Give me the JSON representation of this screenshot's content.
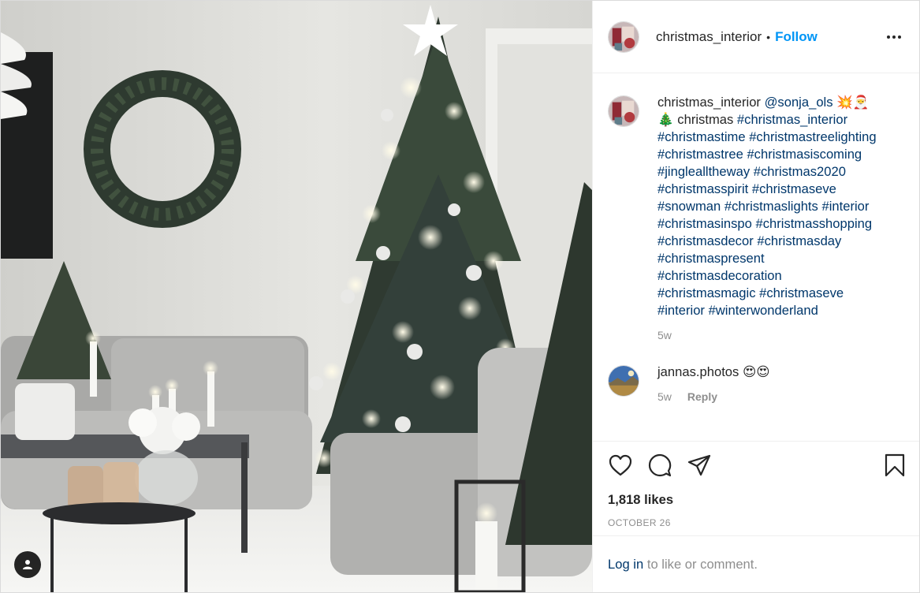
{
  "post": {
    "username": "christmas_interior",
    "separator": "•",
    "follow_label": "Follow",
    "more_icon": "more-horizontal-icon"
  },
  "caption": {
    "username": "christmas_interior",
    "mention": "@sonja_ols",
    "emoji": "💥🎅",
    "line2_emoji": "🎄",
    "line2_word": "christmas",
    "hashtags": [
      "#christmas_interior",
      "#christmastime",
      "#christmastreelighting",
      "#christmastree",
      "#christmasiscoming",
      "#jinglealltheway",
      "#christmas2020",
      "#christmasspirit",
      "#christmaseve",
      "#snowman",
      "#christmaslights",
      "#interior",
      "#christmasinspo",
      "#christmasshopping",
      "#christmasdecor",
      "#christmasday",
      "#christmaspresent",
      "#christmasdecoration",
      "#christmasmagic",
      "#christmaseve",
      "#interior",
      "#winterwonderland"
    ],
    "time": "5w"
  },
  "comments": [
    {
      "username": "jannas.photos",
      "text": "😍😍",
      "time": "5w",
      "reply_label": "Reply"
    }
  ],
  "actions": {
    "like_icon": "heart-icon",
    "comment_icon": "comment-icon",
    "share_icon": "paper-plane-icon",
    "save_icon": "bookmark-icon"
  },
  "likes": "1,818 likes",
  "date": "OCTOBER 26",
  "login": {
    "link": "Log in",
    "rest": " to like or comment."
  },
  "colors": {
    "follow": "#0095f6",
    "hashtag": "#00376b",
    "muted": "#8e8e8e"
  }
}
